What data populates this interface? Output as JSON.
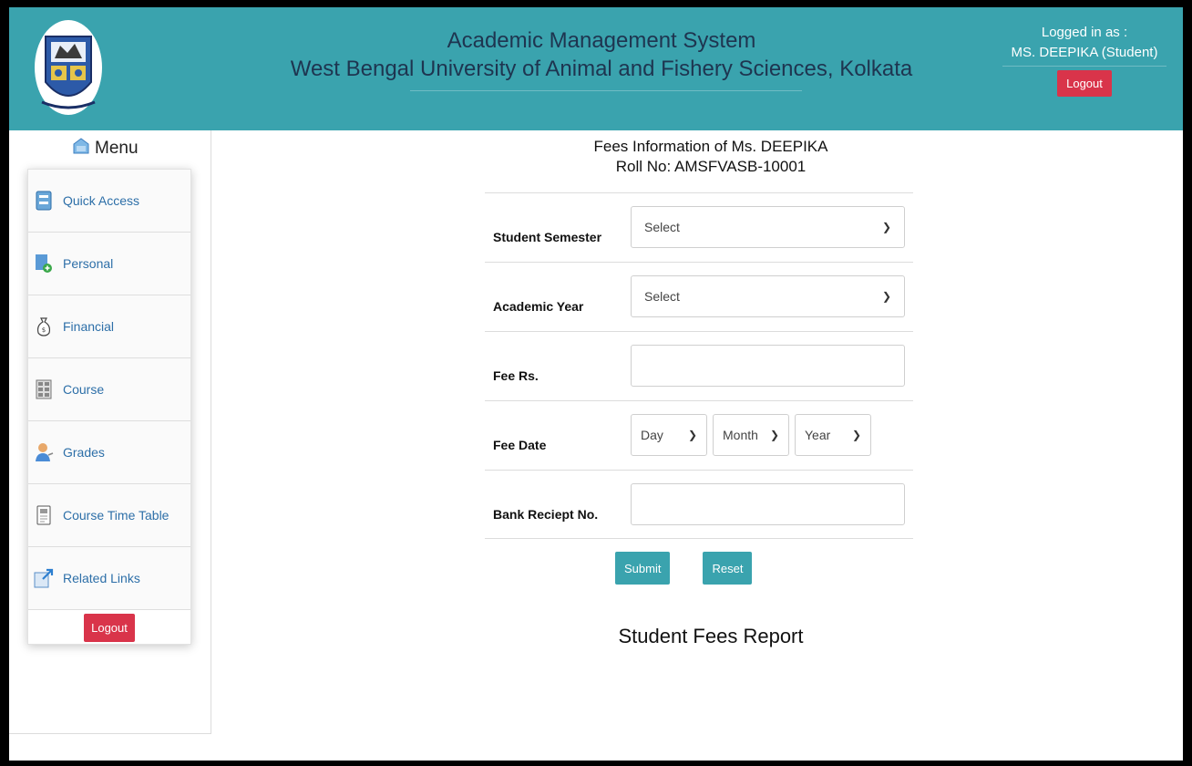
{
  "header": {
    "title_line1": "Academic Management System",
    "title_line2": "West Bengal University of Animal and Fishery Sciences, Kolkata",
    "logged_in_label": "Logged in as :",
    "user_name": "MS. DEEPIKA (Student)",
    "logout_label": "Logout",
    "logo_icon": "university-crest-icon"
  },
  "sidebar": {
    "menu_label": "Menu",
    "items": [
      {
        "label": "Quick Access",
        "icon": "monitor-icon"
      },
      {
        "label": "Personal",
        "icon": "personal-file-icon"
      },
      {
        "label": "Financial",
        "icon": "money-bag-icon"
      },
      {
        "label": "Course",
        "icon": "course-grid-icon"
      },
      {
        "label": "Grades",
        "icon": "grades-user-icon"
      },
      {
        "label": "Course Time Table",
        "icon": "timetable-doc-icon"
      },
      {
        "label": "Related Links",
        "icon": "external-link-icon"
      }
    ],
    "logout_label": "Logout"
  },
  "form": {
    "title_line1": "Fees Information of Ms. DEEPIKA",
    "title_line2": "Roll No: AMSFVASB-10001",
    "semester_label": "Student Semester",
    "semester_value": "Select",
    "year_label": "Academic Year",
    "year_value": "Select",
    "fee_label": "Fee Rs.",
    "fee_value": "",
    "date_label": "Fee Date",
    "date_day": "Day",
    "date_month": "Month",
    "date_year": "Year",
    "receipt_label": "Bank Reciept No.",
    "receipt_value": "",
    "submit_label": "Submit",
    "reset_label": "Reset"
  },
  "report": {
    "title": "Student Fees Report"
  },
  "colors": {
    "header_bg": "#3aa3ae",
    "logout_red": "#d9344a",
    "link_blue": "#2d6fa8"
  }
}
